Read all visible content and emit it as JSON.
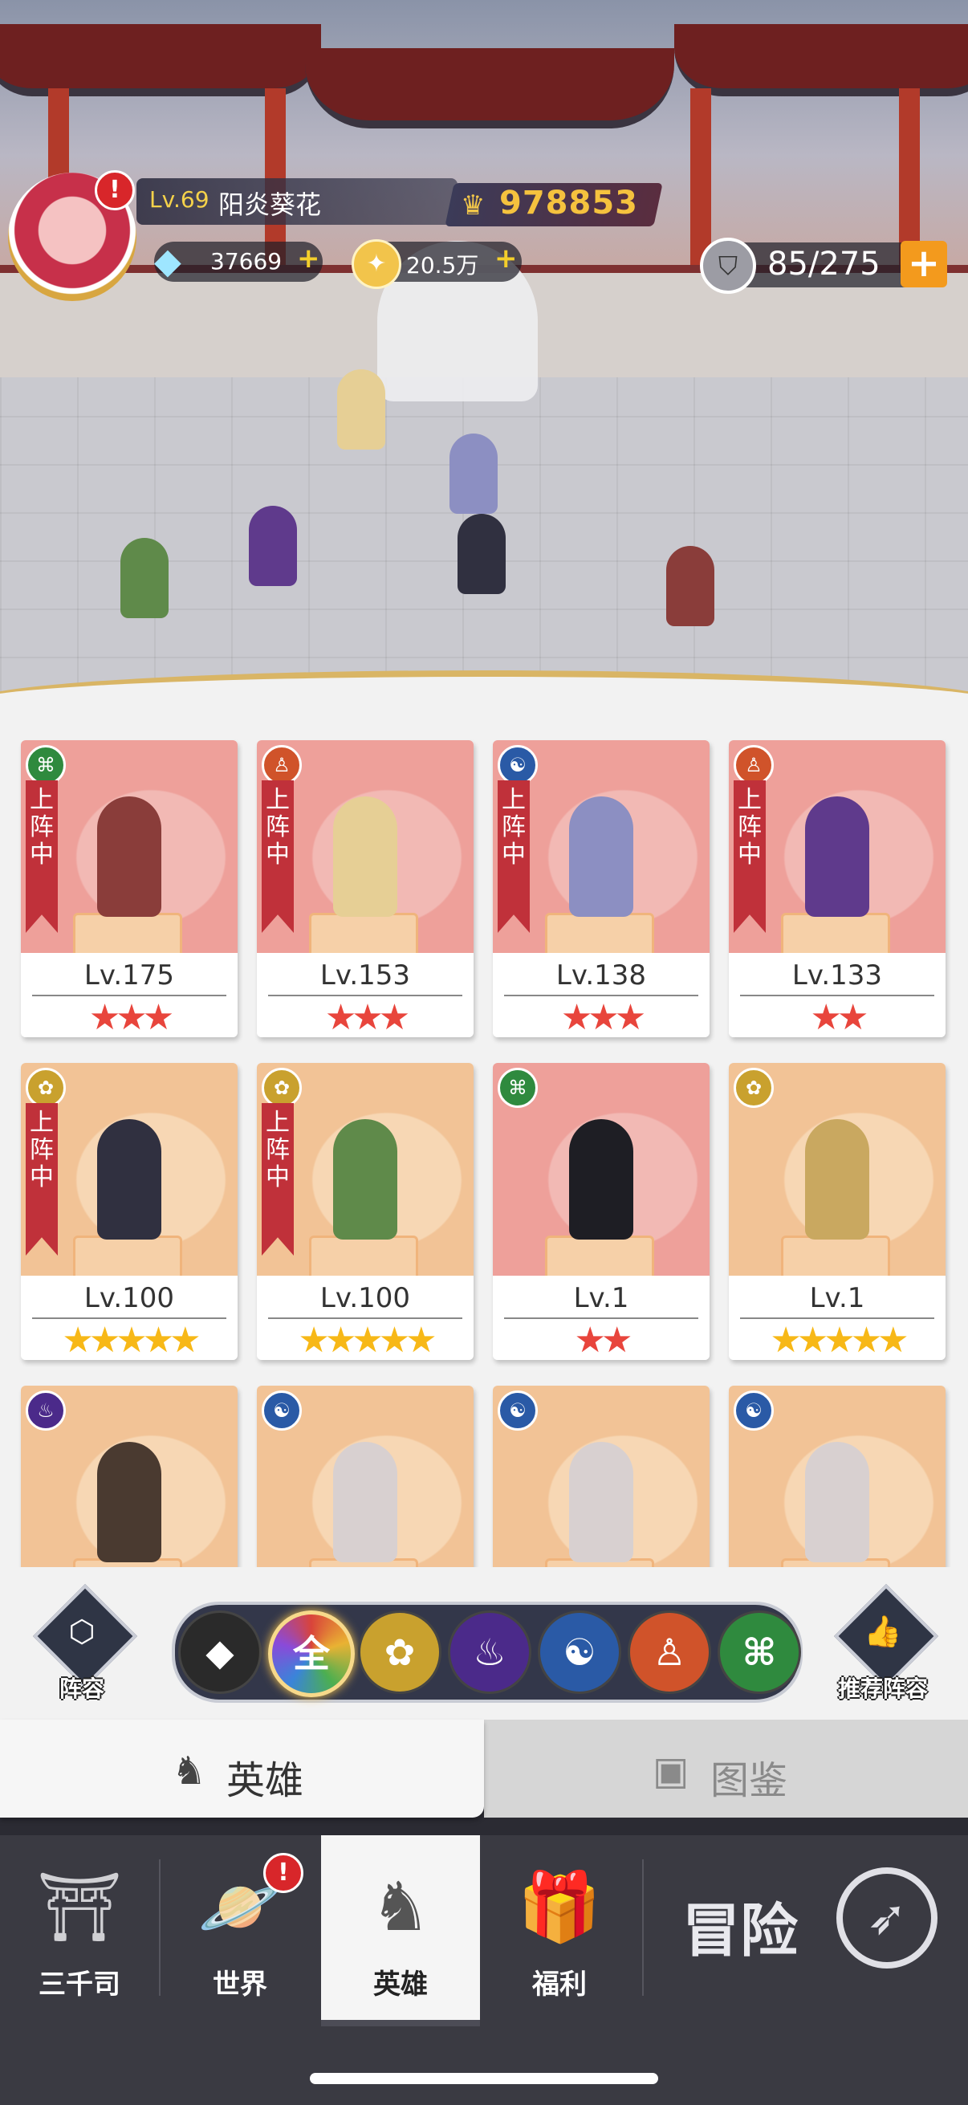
{
  "player": {
    "level": "Lv.69",
    "name": "阳炎葵花",
    "power": "978853",
    "alert": "!"
  },
  "resources": {
    "gems": "37669",
    "gold": "20.5万",
    "stamina": "85/275",
    "plus": "+"
  },
  "cards": [
    {
      "level": "Lv.175",
      "stars": "★★★",
      "tag": "上阵中",
      "faction": "dna",
      "bg": "red",
      "star_color": "red"
    },
    {
      "level": "Lv.153",
      "stars": "★★★",
      "tag": "上阵中",
      "faction": "flame-person",
      "bg": "red",
      "star_color": "red"
    },
    {
      "level": "Lv.138",
      "stars": "★★★",
      "tag": "上阵中",
      "faction": "yin-yang",
      "bg": "red",
      "star_color": "red"
    },
    {
      "level": "Lv.133",
      "stars": "★★",
      "tag": "上阵中",
      "faction": "flame-person",
      "bg": "red",
      "star_color": "red"
    },
    {
      "level": "Lv.100",
      "stars": "★★★★★",
      "tag": "上阵中",
      "faction": "lotus",
      "bg": "gold",
      "star_color": "gold"
    },
    {
      "level": "Lv.100",
      "stars": "★★★★★",
      "tag": "上阵中",
      "faction": "lotus",
      "bg": "gold",
      "star_color": "gold"
    },
    {
      "level": "Lv.1",
      "stars": "★★",
      "tag": "",
      "faction": "dna",
      "bg": "red",
      "star_color": "red"
    },
    {
      "level": "Lv.1",
      "stars": "★★★★★",
      "tag": "",
      "faction": "lotus",
      "bg": "gold",
      "star_color": "gold"
    },
    {
      "level": "",
      "stars": "",
      "tag": "",
      "faction": "shadow-flame",
      "bg": "gold",
      "star_color": "gold"
    },
    {
      "level": "",
      "stars": "",
      "tag": "",
      "faction": "yin-yang",
      "bg": "gold",
      "star_color": "gold"
    },
    {
      "level": "",
      "stars": "",
      "tag": "",
      "faction": "yin-yang",
      "bg": "gold",
      "star_color": "gold"
    },
    {
      "level": "",
      "stars": "",
      "tag": "",
      "faction": "yin-yang",
      "bg": "gold",
      "star_color": "gold"
    }
  ],
  "filter": {
    "lineup_label": "阵容",
    "recommend_label": "推荐阵容",
    "all_label": "全",
    "buttons": [
      "all-classes",
      "all",
      "lotus",
      "shadow-flame",
      "yin-yang",
      "flame-person",
      "dna"
    ]
  },
  "tabs": {
    "heroes": "英雄",
    "codex": "图鉴"
  },
  "nav": {
    "items": [
      "三千司",
      "世界",
      "英雄",
      "福利"
    ],
    "adventure": "冒险",
    "active": "英雄",
    "world_alert": "!"
  },
  "colors": {
    "tag_red": "#c0313a",
    "star_red": "#e8453c",
    "star_gold": "#f7b817",
    "power_gold": "#f5c23e",
    "plus_orange": "#f39a1d"
  }
}
